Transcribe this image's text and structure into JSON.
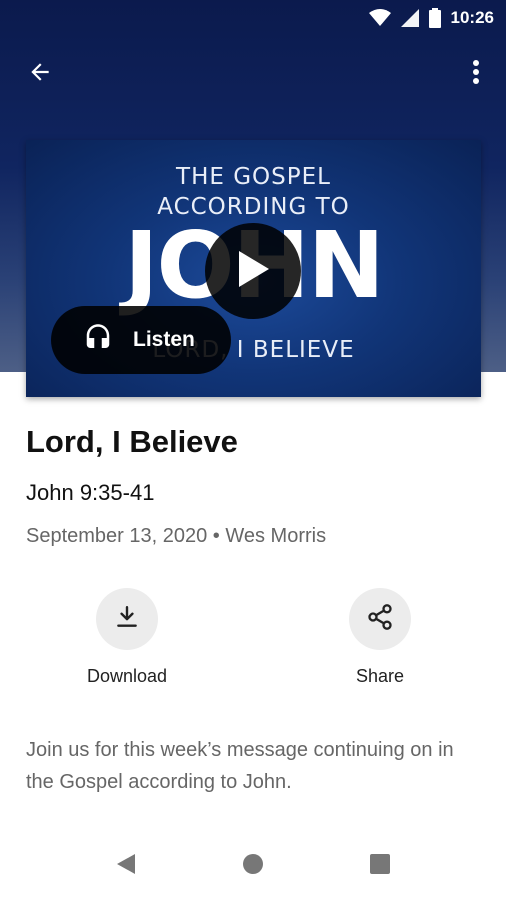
{
  "status_bar": {
    "time": "10:26",
    "icons": [
      "wifi-icon",
      "signal-icon",
      "battery-icon"
    ]
  },
  "app_bar": {
    "back_icon": "arrow-back-icon",
    "menu_icon": "more-vert-icon"
  },
  "artwork": {
    "line1": "THE GOSPEL",
    "line2": "ACCORDING TO",
    "title": "JOHN",
    "subtitle": "LORD, I BELIEVE",
    "play_icon": "play-icon"
  },
  "listen_button": {
    "label": "Listen",
    "icon": "headphones-icon"
  },
  "sermon": {
    "title": "Lord, I Believe",
    "passage": "John 9:35-41",
    "meta": "September 13, 2020 • Wes Morris"
  },
  "actions": [
    {
      "label": "Download",
      "icon": "download-icon"
    },
    {
      "label": "Share",
      "icon": "share-icon"
    }
  ],
  "description": "Join us for this week’s message continuing on in the Gospel according to John.",
  "nav_bar": {
    "icons": [
      "nav-back-icon",
      "nav-home-icon",
      "nav-recents-icon"
    ]
  },
  "colors": {
    "header": "#0b1a4d",
    "artwork": "#113578",
    "button_bg": "#000000",
    "action_circle": "#ececec"
  }
}
